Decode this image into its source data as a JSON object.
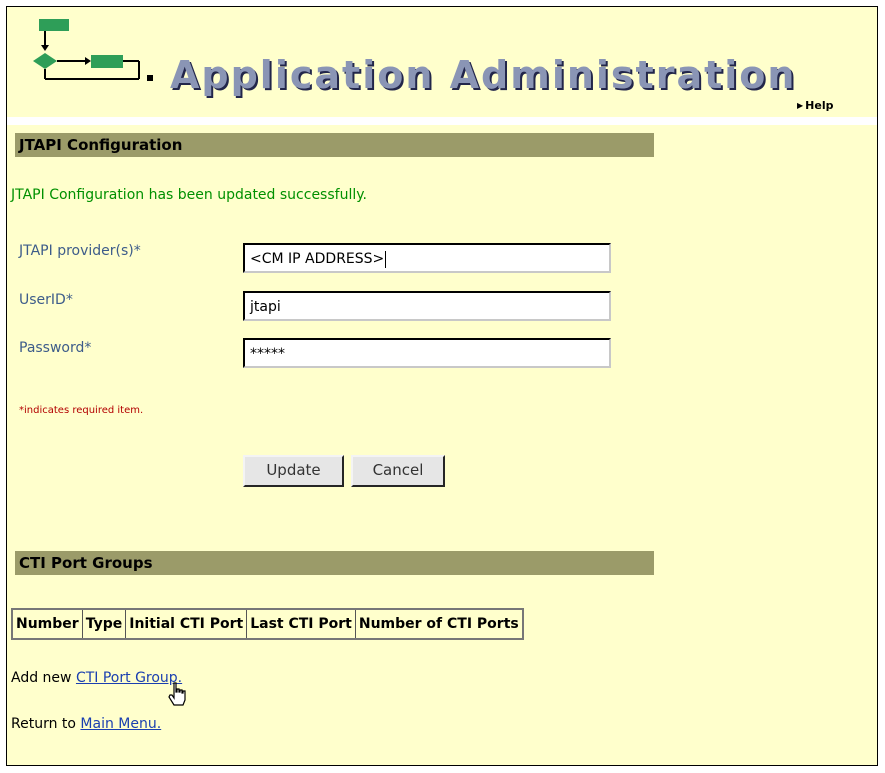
{
  "app": {
    "title": "Application Administration",
    "help_label": "Help"
  },
  "colors": {
    "page_bg": "#ffffcc",
    "section_bar": "#9b9b69",
    "success_text": "#009000",
    "label_text": "#3d5c8a",
    "required_text": "#b30000",
    "link": "#1a3fb0",
    "logo_green": "#2e9e58"
  },
  "jtapi": {
    "section_title": "JTAPI Configuration",
    "success_message": "JTAPI Configuration has been updated successfully.",
    "fields": {
      "provider": {
        "label": "JTAPI provider(s)*",
        "value": "<CM IP ADDRESS>"
      },
      "userid": {
        "label": "UserID*",
        "value": "jtapi"
      },
      "password": {
        "label": "Password*",
        "value": "*****"
      }
    },
    "required_note": "*indicates required item.",
    "update_label": "Update",
    "cancel_label": "Cancel"
  },
  "cti": {
    "section_title": "CTI Port Groups",
    "columns": [
      "Number",
      "Type",
      "Initial CTI Port",
      "Last CTI Port",
      "Number of CTI Ports"
    ],
    "add_prefix": "Add new ",
    "add_link": "CTI Port Group.",
    "return_prefix": "Return to ",
    "return_link": "Main Menu."
  },
  "icons": {
    "logo": "workflow-flowchart-icon",
    "help_arrow": "triangle-right-icon",
    "cursor": "hand-pointer-icon"
  }
}
